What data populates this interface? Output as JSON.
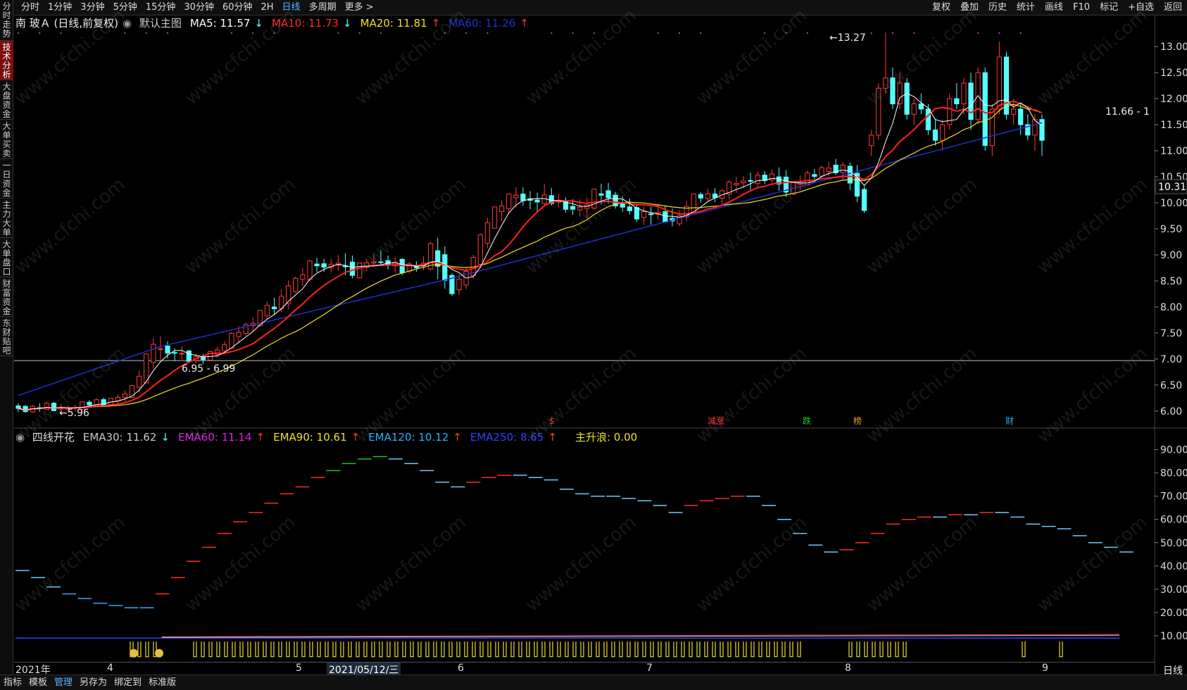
{
  "window": {
    "period_tabs": [
      "分时",
      "1分钟",
      "3分钟",
      "5分钟",
      "15分钟",
      "30分钟",
      "60分钟",
      "2H",
      "日线",
      "多周期",
      "更多"
    ],
    "active_tab": "日线",
    "tools": [
      "复权",
      "叠加",
      "历史",
      "统计",
      "画线",
      "F10",
      "标记",
      "+自选",
      "返回"
    ]
  },
  "left_nav": [
    "分时走势",
    "技术分析",
    "大盘资金",
    "大单买卖",
    "一日资金",
    "主力大单",
    "大单盘口",
    "财富资金",
    "东财贴吧"
  ],
  "left_nav_active": "技术分析",
  "main_legend": {
    "stock": "南 玻Ａ (日线,前复权)",
    "template": "默认主图",
    "ma5": "MA5: 11.57",
    "ma10": "MA10: 11.73",
    "ma20": "MA20: 11.81",
    "ma60": "MA60: 11.26",
    "ma5_arrow": "↓",
    "ma10_arrow": "↓",
    "ma20_arrow": "↑",
    "ma60_arrow": "↑"
  },
  "sub_legend": {
    "name": "四线开花",
    "ema30": "EMA30: 11.62",
    "ema60": "EMA60: 11.14",
    "ema90": "EMA90: 10.61",
    "ema120": "EMA120: 10.12",
    "ema250": "EMA250: 8.65",
    "wave": "主升浪: 0.00",
    "ema30_arrow": "↓",
    "ema60_arrow": "↑",
    "ema90_arrow": "↑",
    "ema120_arrow": "↑",
    "ema250_arrow": "↑"
  },
  "price_axis": [
    "13.00",
    "12.50",
    "12.00",
    "11.50",
    "11.00",
    "10.50",
    "10.00",
    "9.50",
    "9.00",
    "8.50",
    "8.00",
    "7.50",
    "7.00",
    "6.50",
    "6.00"
  ],
  "current_price": "10.31",
  "sub_axis": [
    "90.00",
    "80.00",
    "70.00",
    "60.00",
    "50.00",
    "40.00",
    "30.00",
    "20.00",
    "10.00"
  ],
  "annotations": {
    "high": "13.27",
    "low": "5.96",
    "range1": "6.95 - 6.99",
    "range2": "11.66 - 1"
  },
  "event_markers": [
    "$",
    "减涨",
    "跌",
    "榜",
    "财"
  ],
  "x_axis": {
    "labels": [
      "2021年",
      "4",
      "5",
      "6",
      "7",
      "8",
      "9"
    ],
    "selected_date": "2021/05/12/三",
    "period_label": "日线"
  },
  "bottom_buttons": [
    "指标",
    "模板",
    "管理",
    "另存为",
    "绑定到",
    "标准版"
  ],
  "bottom_active": "管理",
  "watermark": "www.cfchi.com",
  "colors": {
    "up": "#ff3a3a",
    "down": "#54ffff",
    "ma5": "#ffffff",
    "ma10": "#ff2020",
    "ma20": "#f0e020",
    "ma60": "#2030d0",
    "ema30": "#c8c8c8",
    "ema60": "#e020e0",
    "ema90": "#f0e020",
    "ema120": "#2ab0ff",
    "ema250": "#3040ff"
  },
  "chart_data": [
    {
      "type": "candlestick",
      "title": "南 玻Ａ (日线,前复权)",
      "ylim": [
        5.7,
        13.3
      ],
      "ohlc_daily": [
        [
          6.1,
          6.15,
          5.98,
          6.05
        ],
        [
          6.05,
          6.1,
          5.96,
          6.0
        ],
        [
          6.0,
          6.15,
          5.98,
          6.12
        ],
        [
          6.12,
          6.2,
          6.05,
          6.08
        ],
        [
          6.08,
          6.15,
          6.0,
          6.02
        ],
        [
          6.02,
          6.1,
          5.97,
          6.06
        ],
        [
          6.06,
          6.14,
          6.02,
          6.12
        ],
        [
          6.12,
          6.22,
          6.08,
          6.18
        ],
        [
          6.18,
          6.26,
          6.1,
          6.14
        ],
        [
          6.14,
          6.25,
          6.1,
          6.22
        ],
        [
          6.22,
          6.35,
          6.15,
          6.3
        ],
        [
          6.3,
          6.5,
          6.25,
          6.45
        ],
        [
          6.45,
          6.9,
          6.4,
          6.85
        ],
        [
          6.85,
          7.4,
          6.8,
          7.35
        ],
        [
          7.35,
          7.45,
          7.05,
          7.1
        ],
        [
          7.1,
          7.2,
          6.95,
          7.15
        ],
        [
          7.15,
          7.25,
          7.0,
          7.05
        ],
        [
          7.05,
          7.1,
          6.92,
          6.97
        ],
        [
          6.97,
          7.1,
          6.9,
          7.05
        ],
        [
          7.05,
          7.2,
          7.0,
          7.15
        ],
        [
          7.15,
          7.35,
          7.1,
          7.3
        ],
        [
          7.3,
          7.6,
          7.25,
          7.55
        ],
        [
          7.55,
          7.7,
          7.45,
          7.6
        ],
        [
          7.6,
          7.85,
          7.55,
          7.8
        ],
        [
          7.8,
          8.1,
          7.75,
          8.05
        ],
        [
          8.05,
          8.2,
          7.9,
          7.95
        ],
        [
          7.95,
          8.5,
          7.9,
          8.45
        ],
        [
          8.45,
          8.6,
          8.35,
          8.5
        ],
        [
          8.5,
          8.9,
          8.45,
          8.85
        ],
        [
          8.85,
          8.95,
          8.7,
          8.8
        ],
        [
          8.8,
          8.9,
          8.65,
          8.75
        ],
        [
          8.75,
          9.0,
          8.7,
          8.9
        ],
        [
          8.9,
          9.05,
          8.55,
          8.6
        ],
        [
          8.6,
          8.85,
          8.55,
          8.8
        ],
        [
          8.8,
          8.95,
          8.75,
          8.9
        ],
        [
          8.9,
          9.1,
          8.8,
          8.82
        ],
        [
          8.82,
          8.95,
          8.7,
          8.88
        ],
        [
          8.88,
          8.95,
          8.6,
          8.7
        ],
        [
          8.7,
          8.85,
          8.65,
          8.8
        ],
        [
          8.8,
          8.9,
          8.7,
          8.75
        ],
        [
          8.75,
          9.3,
          8.7,
          9.25
        ],
        [
          9.25,
          9.35,
          8.4,
          8.5
        ],
        [
          8.5,
          8.6,
          8.2,
          8.3
        ],
        [
          8.3,
          8.65,
          8.25,
          8.6
        ],
        [
          8.6,
          9.0,
          8.55,
          8.95
        ],
        [
          8.95,
          9.6,
          8.9,
          9.55
        ],
        [
          9.55,
          9.9,
          9.5,
          9.85
        ],
        [
          9.85,
          10.1,
          9.7,
          10.05
        ],
        [
          10.05,
          10.3,
          9.9,
          10.2
        ],
        [
          10.2,
          10.3,
          9.95,
          10.0
        ],
        [
          10.0,
          10.15,
          9.8,
          10.05
        ],
        [
          10.05,
          10.4,
          9.95,
          10.1
        ],
        [
          10.1,
          10.2,
          9.95,
          10.0
        ],
        [
          10.0,
          10.1,
          9.8,
          9.9
        ],
        [
          9.9,
          10.05,
          9.75,
          9.85
        ],
        [
          9.85,
          10.1,
          9.7,
          10.0
        ],
        [
          10.0,
          10.35,
          9.95,
          10.3
        ],
        [
          10.3,
          10.4,
          10.0,
          10.05
        ],
        [
          10.05,
          10.15,
          9.85,
          9.95
        ],
        [
          9.95,
          10.1,
          9.8,
          9.85
        ],
        [
          9.85,
          9.95,
          9.6,
          9.7
        ],
        [
          9.7,
          9.9,
          9.55,
          9.85
        ],
        [
          9.85,
          10.0,
          9.7,
          9.75
        ],
        [
          9.75,
          9.9,
          9.55,
          9.6
        ],
        [
          9.6,
          9.85,
          9.55,
          9.75
        ],
        [
          9.75,
          10.15,
          9.7,
          10.1
        ],
        [
          10.1,
          10.2,
          10.0,
          10.15
        ],
        [
          10.15,
          10.3,
          10.05,
          10.1
        ],
        [
          10.1,
          10.25,
          9.95,
          10.2
        ],
        [
          10.2,
          10.5,
          10.1,
          10.45
        ],
        [
          10.45,
          10.5,
          10.3,
          10.35
        ],
        [
          10.35,
          10.6,
          10.2,
          10.5
        ],
        [
          10.5,
          10.6,
          10.35,
          10.45
        ],
        [
          10.45,
          10.65,
          10.4,
          10.55
        ],
        [
          10.55,
          10.7,
          10.1,
          10.2
        ],
        [
          10.2,
          10.4,
          10.15,
          10.35
        ],
        [
          10.35,
          10.6,
          10.3,
          10.5
        ],
        [
          10.5,
          10.65,
          10.45,
          10.55
        ],
        [
          10.55,
          10.75,
          10.5,
          10.7
        ],
        [
          10.7,
          10.85,
          10.55,
          10.6
        ],
        [
          10.6,
          10.75,
          10.4,
          10.7
        ],
        [
          10.7,
          10.8,
          10.05,
          10.1
        ],
        [
          10.1,
          10.2,
          9.75,
          9.85
        ],
        [
          9.85,
          10.3,
          9.8,
          10.25
        ],
        [
          10.25,
          11.4,
          10.2,
          11.3
        ],
        [
          11.3,
          12.5,
          11.2,
          12.2
        ],
        [
          12.2,
          12.4,
          11.5,
          11.6
        ],
        [
          11.6,
          12.15,
          11.5,
          12.0
        ],
        [
          12.0,
          12.1,
          11.6,
          11.7
        ],
        [
          11.7,
          11.9,
          11.55,
          11.8
        ],
        [
          11.8,
          11.9,
          11.5,
          11.6
        ],
        [
          11.6,
          11.75,
          11.45,
          11.65
        ],
        [
          11.65,
          11.8,
          11.55,
          11.7
        ],
        [
          11.7,
          11.8,
          11.2,
          11.3
        ],
        [
          11.3,
          11.5,
          11.0,
          11.1
        ],
        [
          11.1,
          11.2,
          9.6,
          9.75
        ],
        [
          9.75,
          9.85,
          9.0,
          9.2
        ],
        [
          9.2,
          9.6,
          9.1,
          9.5
        ],
        [
          9.5,
          10.2,
          9.45,
          10.15
        ],
        [
          10.15,
          11.2,
          10.1,
          11.1
        ]
      ],
      "annotated_high": 13.27,
      "annotated_low": 5.96
    },
    {
      "type": "indicator",
      "title": "四线开花",
      "ylim": [
        0,
        92
      ],
      "series": [
        {
          "name": "EMA30",
          "values": [
            38,
            35,
            31,
            28,
            26,
            24,
            23,
            22,
            22,
            28,
            35,
            42,
            48,
            54,
            59,
            63,
            67,
            71,
            74,
            78,
            81,
            84,
            86,
            87,
            86,
            84,
            81,
            76,
            74,
            76,
            78,
            79,
            79,
            78,
            77,
            73,
            71,
            70,
            70,
            69,
            68,
            66,
            63,
            66,
            68,
            69,
            70,
            70,
            66,
            60,
            54,
            49,
            46,
            47,
            50,
            54,
            58,
            60,
            61,
            61,
            62,
            62,
            63,
            63,
            61,
            58,
            57,
            56,
            53,
            50,
            48,
            46
          ]
        }
      ]
    }
  ]
}
